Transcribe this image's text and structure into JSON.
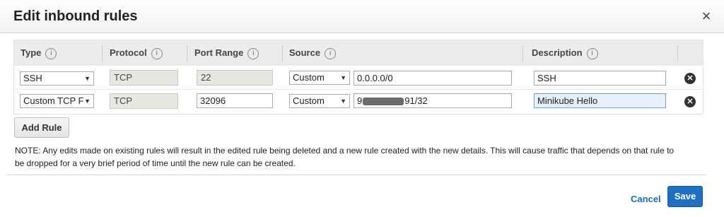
{
  "dialog": {
    "title": "Edit inbound rules",
    "close_icon": "×"
  },
  "columns": [
    {
      "label": "Type"
    },
    {
      "label": "Protocol"
    },
    {
      "label": "Port Range"
    },
    {
      "label": "Source"
    },
    {
      "label": "Description"
    }
  ],
  "info_icon": "i",
  "rules": [
    {
      "type": "SSH",
      "protocol": "TCP",
      "port_range": "22",
      "source_mode": "Custom",
      "source_value": "0.0.0.0/0",
      "description": "SSH"
    },
    {
      "type": "Custom TCP F",
      "protocol": "TCP",
      "port_range": "32096",
      "source_mode": "Custom",
      "source_value_prefix": "9",
      "source_value_suffix": "91/32",
      "description": "Minikube Hello"
    }
  ],
  "caret": "▼",
  "delete_icon": "✕",
  "add_rule_label": "Add Rule",
  "note": "NOTE: Any edits made on existing rules will result in the edited rule being deleted and a new rule created with the new details. This will cause traffic that depends on that rule to be dropped for a very brief period of time until the new rule can be created.",
  "footer": {
    "cancel_label": "Cancel",
    "save_label": "Save"
  }
}
